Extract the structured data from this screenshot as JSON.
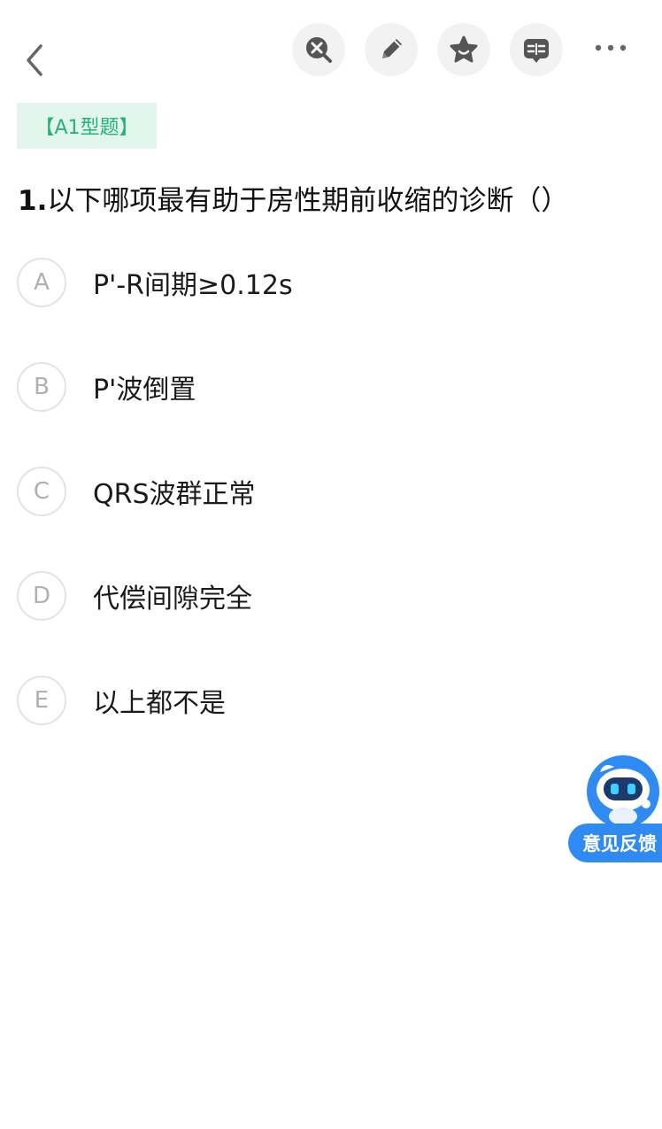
{
  "header": {
    "back_icon": "chevron-left-icon",
    "tools": [
      {
        "name": "exit-search-icon"
      },
      {
        "name": "pencil-icon"
      },
      {
        "name": "star-icon"
      },
      {
        "name": "notes-icon"
      }
    ],
    "more_icon": "more-icon"
  },
  "question": {
    "type_label": "【A1型题】",
    "number": "1.",
    "text": "以下哪项最有助于房性期前收缩的诊断（）",
    "options": [
      {
        "letter": "A",
        "text": "P'-R间期≥0.12s"
      },
      {
        "letter": "B",
        "text": "P'波倒置"
      },
      {
        "letter": "C",
        "text": "QRS波群正常"
      },
      {
        "letter": "D",
        "text": "代偿间隙完全"
      },
      {
        "letter": "E",
        "text": "以上都不是"
      }
    ]
  },
  "feedback": {
    "label": "意见反馈"
  },
  "colors": {
    "accent_green": "#22b47a",
    "tag_bg": "#e3f6ee",
    "feedback_blue": "#2f8bf2",
    "icon_gray": "#555555"
  }
}
